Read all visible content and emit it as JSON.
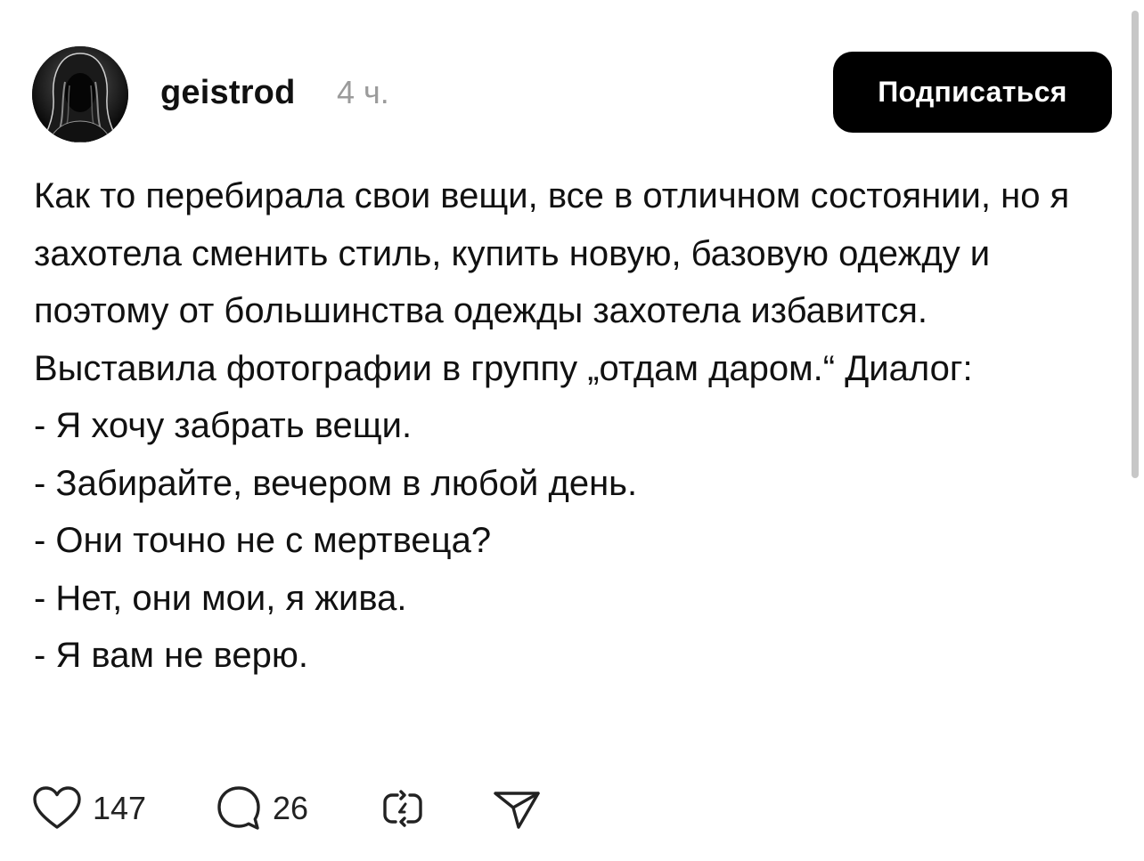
{
  "post": {
    "author": {
      "username": "geistrod",
      "time_ago": "4 ч."
    },
    "subscribe_label": "Подписаться",
    "paragraphs": [
      "Как то перебирала свои вещи, все в отличном состоянии, но я захотела сменить стиль, купить новую, базовую одежду и поэтому от большинства одежды захотела избавится. Выставила фотографии в группу „отдам даром.“ Диалог:",
      "- Я хочу забрать вещи.",
      "- Забирайте, вечером в любой день.",
      "- Они точно не с мертвеца?",
      "- Нет, они мои, я жива.",
      "- Я вам не верю."
    ],
    "actions": {
      "like_count": "147",
      "comment_count": "26"
    }
  },
  "icons": {
    "like": "heart-icon",
    "comment": "speech-bubble-icon",
    "repost": "repost-arrows-icon",
    "share": "paper-plane-icon"
  },
  "colors": {
    "button_bg": "#000000",
    "button_text": "#ffffff",
    "timestamp": "#9b9b9b",
    "text": "#111111"
  }
}
